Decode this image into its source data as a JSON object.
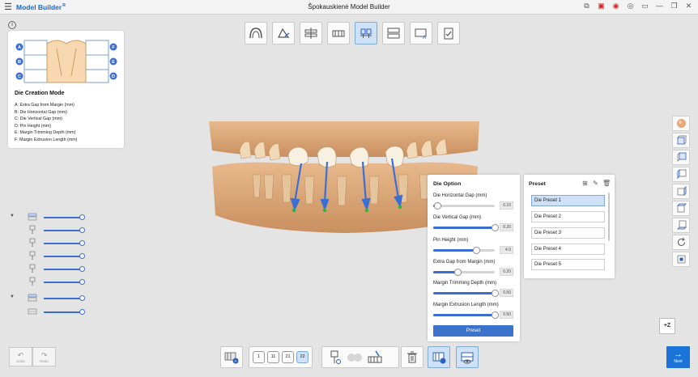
{
  "app": {
    "name": "Model Builder",
    "name_sup": "R",
    "window_title": "Špokauskienė Model Builder"
  },
  "window_controls": [
    "screenshot-icon",
    "record-frame-icon",
    "record-icon",
    "camera-icon",
    "window-icon",
    "minimize-icon",
    "maximize-icon",
    "close-icon"
  ],
  "top_toolbar": [
    {
      "name": "arch-model-tool",
      "active": false
    },
    {
      "name": "trim-tool",
      "active": false
    },
    {
      "name": "base-tool",
      "active": false
    },
    {
      "name": "base-plate-tool",
      "active": false
    },
    {
      "name": "die-tool",
      "active": true
    },
    {
      "name": "articulator-tool",
      "active": false
    },
    {
      "name": "auto-base-tool",
      "active": false
    },
    {
      "name": "checklist-tool",
      "active": false
    }
  ],
  "info": {
    "button_glyph": "i",
    "diagram_labels": [
      "A",
      "B",
      "C",
      "F",
      "E",
      "D"
    ],
    "title": "Die Creation Mode",
    "items": [
      "A: Extra Gap from Margin (mm)",
      "B: Die Horizontal Gap (mm)",
      "C: Die Vertical Gap (mm)",
      "D: Pin Height (mm)",
      "E: Margin Trimming Depth (mm)",
      "F: Margin Extrusion Length (mm)"
    ]
  },
  "layers": [
    {
      "icon": "arch-layer-icon",
      "expanded": true,
      "opacity": 1.0
    },
    {
      "icon": "die-layer-icon",
      "expanded": false,
      "opacity": 1.0
    },
    {
      "icon": "die-layer-icon",
      "expanded": false,
      "opacity": 1.0
    },
    {
      "icon": "die-layer-icon",
      "expanded": false,
      "opacity": 1.0
    },
    {
      "icon": "die-layer-icon",
      "expanded": false,
      "opacity": 1.0
    },
    {
      "icon": "die-layer-icon",
      "expanded": false,
      "opacity": 1.0
    },
    {
      "icon": "arch-layer-icon",
      "expanded": true,
      "opacity": 1.0
    },
    {
      "icon": "base-layer-icon",
      "expanded": false,
      "opacity": 1.0
    }
  ],
  "die_option": {
    "title": "Die Option",
    "options": [
      {
        "label": "Die Horizontal Gap (mm)",
        "value": "0.10",
        "level": 0.07
      },
      {
        "label": "Die Vertical Gap (mm)",
        "value": "0.20",
        "level": 1.0
      },
      {
        "label": "Pin Height (mm)",
        "value": "4.0",
        "level": 0.71
      },
      {
        "label": "Extra Gap from Margin (mm)",
        "value": "0.20",
        "level": 0.4
      },
      {
        "label": "Margin Trimming Depth (mm)",
        "value": "0.50",
        "level": 1.0
      },
      {
        "label": "Margin Extrusion Length (mm)",
        "value": "0.50",
        "level": 1.0
      }
    ],
    "preset_button": "Preset"
  },
  "preset": {
    "title": "Preset",
    "actions": [
      "add-icon",
      "edit-icon",
      "delete-icon"
    ],
    "items": [
      "Die Preset 1",
      "Die Preset 2",
      "Die Preset 3",
      "Die Preset 4",
      "Die Preset 5"
    ],
    "selected_index": 0
  },
  "view_bar": [
    "color-sphere-icon",
    "front-view-icon",
    "back-view-icon",
    "left-view-icon",
    "right-view-icon",
    "top-view-icon",
    "bottom-view-icon",
    "rotate-icon",
    "fit-view-icon"
  ],
  "z_button": "+Z",
  "bottom": {
    "undo": "Undo",
    "redo": "Redo",
    "sequence": [
      "1",
      "11",
      "21",
      "22"
    ],
    "sequence_active": 3,
    "next": "Next"
  },
  "colors": {
    "accent": "#3a73c9",
    "next": "#1a74d8",
    "selected": "#cfe1f6"
  }
}
